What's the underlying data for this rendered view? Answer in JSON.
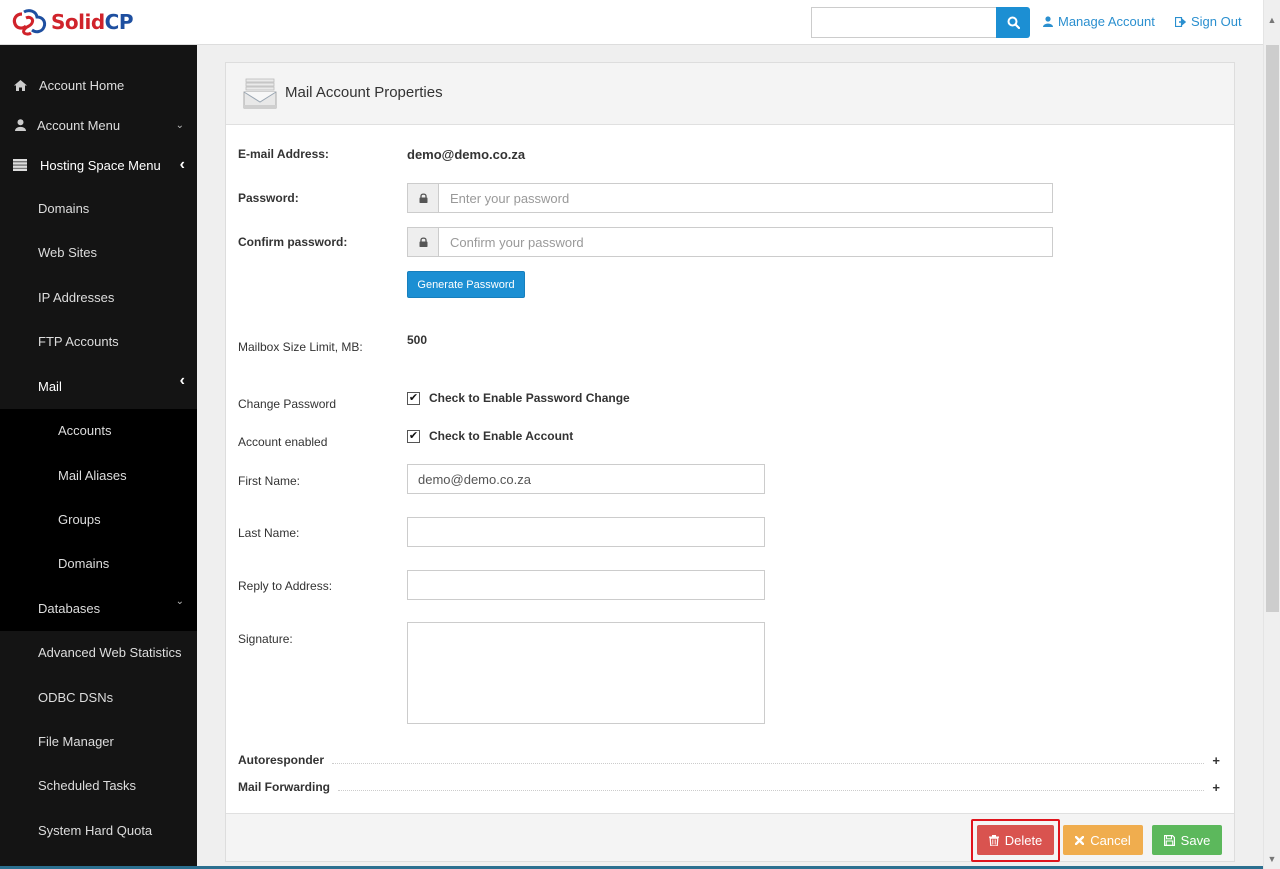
{
  "header": {
    "logo_solid": "Solid",
    "logo_cp": "CP",
    "search_value": "",
    "search_icon": "search-icon",
    "manage_account": "Manage Account",
    "sign_out": "Sign Out"
  },
  "sidebar": {
    "items": [
      {
        "label": "Account Home",
        "icon": "home-icon"
      },
      {
        "label": "Account Menu",
        "icon": "user-icon",
        "chevron": "down"
      },
      {
        "label": "Hosting Space Menu",
        "icon": "list-icon",
        "chevron": "left"
      },
      {
        "label": "Domains"
      },
      {
        "label": "Web Sites"
      },
      {
        "label": "IP Addresses"
      },
      {
        "label": "FTP Accounts"
      },
      {
        "label": "Mail",
        "chevron": "left"
      },
      {
        "label": "Accounts"
      },
      {
        "label": "Mail Aliases"
      },
      {
        "label": "Groups"
      },
      {
        "label": "Domains"
      },
      {
        "label": "Databases",
        "chevron": "down"
      },
      {
        "label": "Advanced Web Statistics"
      },
      {
        "label": "ODBC DSNs"
      },
      {
        "label": "File Manager"
      },
      {
        "label": "Scheduled Tasks"
      },
      {
        "label": "System Hard Quota"
      }
    ]
  },
  "panel": {
    "title": "Mail Account Properties",
    "email_label": "E-mail Address:",
    "email_value": "demo@demo.co.za",
    "password_label": "Password:",
    "password_placeholder": "Enter your password",
    "confirm_label": "Confirm password:",
    "confirm_placeholder": "Confirm your password",
    "generate_button": "Generate Password",
    "mailbox_label": "Mailbox Size Limit, MB:",
    "mailbox_value": "500",
    "change_password_label": "Change Password",
    "change_password_checkbox": "Check to Enable Password Change",
    "change_password_checked": true,
    "account_enabled_label": "Account enabled",
    "account_enabled_checkbox": "Check to Enable Account",
    "account_enabled_checked": true,
    "first_name_label": "First Name:",
    "first_name_value": "demo@demo.co.za",
    "last_name_label": "Last Name:",
    "last_name_value": "",
    "reply_to_label": "Reply to Address:",
    "reply_to_value": "",
    "signature_label": "Signature:",
    "signature_value": "",
    "sections": [
      {
        "label": "Autoresponder",
        "toggle": "+"
      },
      {
        "label": "Mail Forwarding",
        "toggle": "+"
      }
    ]
  },
  "footer": {
    "delete": "Delete",
    "cancel": "Cancel",
    "save": "Save"
  },
  "colors": {
    "primary": "#1c8fd3",
    "danger": "#d9534f",
    "warning": "#f0ad4e",
    "success": "#5cb85c",
    "sidebar_bg": "#141414",
    "highlight_border": "#e0141d"
  }
}
